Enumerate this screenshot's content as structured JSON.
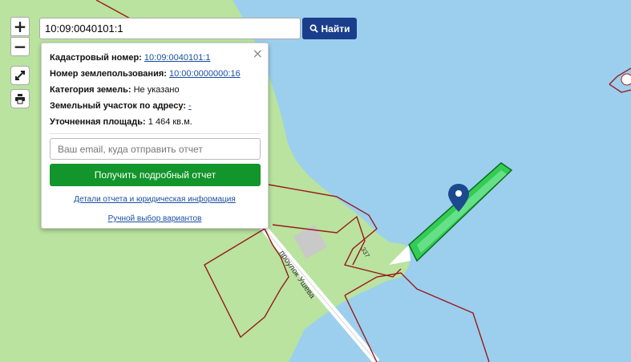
{
  "search": {
    "value": "10:09:0040101:1",
    "button_label": "Найти"
  },
  "map_controls": {
    "zoom_in": "+",
    "zoom_out": "−"
  },
  "popup": {
    "close": "×",
    "cadastral_label": "Кадастровый номер:",
    "cadastral_value": "10:09:0040101:1",
    "landuse_label": "Номер землепользования:",
    "landuse_value": "10:00:0000000:16",
    "category_label": "Категория земель:",
    "category_value": "Не указано",
    "address_label": "Земельный участок по адресу:",
    "address_value": "-",
    "area_label": "Уточненная площадь:",
    "area_value": "1 464 кв.м.",
    "email_placeholder": "Ваш email, куда отправить отчет",
    "report_button": "Получить подробный отчет",
    "details_link": "Детали отчета и юридическая информация",
    "manual_link": "Ручной выбор вариантов"
  },
  "map_labels": {
    "street": "проулок Ушева",
    "parcel_number": "337"
  },
  "colors": {
    "water": "#9ccaee",
    "land": "#b9e39f",
    "parcel_border": "#9a1b1b",
    "highlight": "#33cc55",
    "marker": "#1c4a8f"
  }
}
